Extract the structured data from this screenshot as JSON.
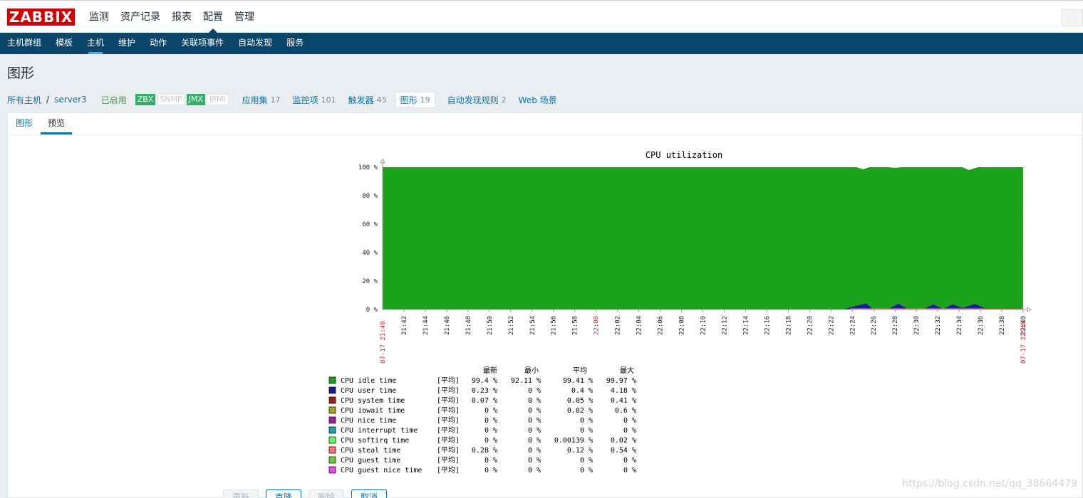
{
  "brand": {
    "logo": "ZABBIX",
    "accent": "#d40000",
    "nav_bg": "#0a466a"
  },
  "topmenu": [
    {
      "label": "监测",
      "active": false
    },
    {
      "label": "资产记录",
      "active": false
    },
    {
      "label": "报表",
      "active": false
    },
    {
      "label": "配置",
      "active": true
    },
    {
      "label": "管理",
      "active": false
    }
  ],
  "submenu": [
    {
      "label": "主机群组",
      "active": false
    },
    {
      "label": "模板",
      "active": false
    },
    {
      "label": "主机",
      "active": true
    },
    {
      "label": "维护",
      "active": false
    },
    {
      "label": "动作",
      "active": false
    },
    {
      "label": "关联项事件",
      "active": false
    },
    {
      "label": "自动发现",
      "active": false
    },
    {
      "label": "服务",
      "active": false
    }
  ],
  "page_title": "图形",
  "hostnav": {
    "all_hosts": "所有主机",
    "separator": "/",
    "host": "server3",
    "status": "已启用",
    "availability": [
      {
        "label": "ZBX",
        "on": true
      },
      {
        "label": "SNMP",
        "on": false
      },
      {
        "label": "JMX",
        "on": true
      },
      {
        "label": "IPMI",
        "on": false
      }
    ],
    "links": [
      {
        "label": "应用集",
        "count": "17"
      },
      {
        "label": "监控项",
        "count": "101"
      },
      {
        "label": "触发器",
        "count": "45"
      },
      {
        "label": "图形",
        "count": "19"
      },
      {
        "label": "自动发现规则",
        "count": "2"
      },
      {
        "label": "Web 场景",
        "count": ""
      }
    ]
  },
  "tabs": [
    {
      "label": "图形",
      "active": false
    },
    {
      "label": "预览",
      "active": true
    }
  ],
  "chart_data": {
    "type": "area",
    "title": "CPU utilization",
    "y_ticks": [
      "100 %",
      "80 %",
      "60 %",
      "40 %",
      "20 %",
      "0 %"
    ],
    "ylim": [
      0,
      100
    ],
    "x_ticks": [
      "21:42",
      "21:44",
      "21:46",
      "21:48",
      "21:50",
      "21:52",
      "21:54",
      "21:56",
      "21:58",
      "22:00",
      "22:02",
      "22:04",
      "22:06",
      "22:08",
      "22:10",
      "22:12",
      "22:14",
      "22:16",
      "22:18",
      "22:20",
      "22:22",
      "22:24",
      "22:26",
      "22:28",
      "22:30",
      "22:32",
      "22:34",
      "22:36",
      "22:38",
      "22:40"
    ],
    "x_start_label": "07-17 21:40",
    "x_end_label": "07-17 22:40",
    "x_highlight_tick": "22:00",
    "series_user_profile": [
      [
        0,
        0
      ],
      [
        0.72,
        0
      ],
      [
        0.73,
        1.5
      ],
      [
        0.755,
        4.2
      ],
      [
        0.765,
        0.5
      ],
      [
        0.79,
        0.5
      ],
      [
        0.805,
        4
      ],
      [
        0.82,
        0.5
      ],
      [
        0.845,
        0.5
      ],
      [
        0.86,
        3.5
      ],
      [
        0.875,
        0.5
      ],
      [
        0.89,
        3.5
      ],
      [
        0.905,
        1
      ],
      [
        0.925,
        3.8
      ],
      [
        0.94,
        1
      ],
      [
        1,
        1
      ]
    ],
    "idle_dips": [
      [
        0,
        100
      ],
      [
        0.74,
        100
      ],
      [
        0.75,
        98.5
      ],
      [
        0.76,
        100
      ],
      [
        0.79,
        100
      ],
      [
        0.8,
        99.5
      ],
      [
        0.81,
        100
      ],
      [
        0.905,
        100
      ],
      [
        0.915,
        98
      ],
      [
        0.93,
        100
      ],
      [
        1,
        100
      ]
    ],
    "legend_header": [
      "最新",
      "最小",
      "平均",
      "最大"
    ],
    "legend": [
      {
        "name": "CPU idle time",
        "color": "#1aa31a",
        "func": "[平均]",
        "last": "99.4 %",
        "min": "92.11 %",
        "avg": "99.41 %",
        "max": "99.97 %"
      },
      {
        "name": "CPU user time",
        "color": "#1a1aa3",
        "func": "[平均]",
        "last": "0.23 %",
        "min": "0 %",
        "avg": "0.4 %",
        "max": "4.18 %"
      },
      {
        "name": "CPU system time",
        "color": "#a31a1a",
        "func": "[平均]",
        "last": "0.07 %",
        "min": "0 %",
        "avg": "0.05 %",
        "max": "0.41 %"
      },
      {
        "name": "CPU iowait time",
        "color": "#a3a31a",
        "func": "[平均]",
        "last": "0 %",
        "min": "0 %",
        "avg": "0.02 %",
        "max": "0.6 %"
      },
      {
        "name": "CPU nice time",
        "color": "#a31aa3",
        "func": "[平均]",
        "last": "0 %",
        "min": "0 %",
        "avg": "0 %",
        "max": "0 %"
      },
      {
        "name": "CPU interrupt time",
        "color": "#1aa3a3",
        "func": "[平均]",
        "last": "0 %",
        "min": "0 %",
        "avg": "0 %",
        "max": "0 %"
      },
      {
        "name": "CPU softirq time",
        "color": "#5cff5c",
        "func": "[平均]",
        "last": "0 %",
        "min": "0 %",
        "avg": "0.00139 %",
        "max": "0.02 %"
      },
      {
        "name": "CPU steal time",
        "color": "#ff7070",
        "func": "[平均]",
        "last": "0.28 %",
        "min": "0 %",
        "avg": "0.12 %",
        "max": "0.54 %"
      },
      {
        "name": "CPU guest time",
        "color": "#6ccc35",
        "func": "[平均]",
        "last": "0 %",
        "min": "0 %",
        "avg": "0 %",
        "max": "0 %"
      },
      {
        "name": "CPU guest nice time",
        "color": "#ec47ec",
        "func": "[平均]",
        "last": "0 %",
        "min": "0 %",
        "avg": "0 %",
        "max": "0 %"
      }
    ]
  },
  "buttons": [
    {
      "label": "更新",
      "disabled": true
    },
    {
      "label": "克隆",
      "disabled": false
    },
    {
      "label": "删除",
      "disabled": true
    },
    {
      "label": "取消",
      "disabled": false
    }
  ],
  "watermark": "https://blog.csdn.net/qq_38664479"
}
